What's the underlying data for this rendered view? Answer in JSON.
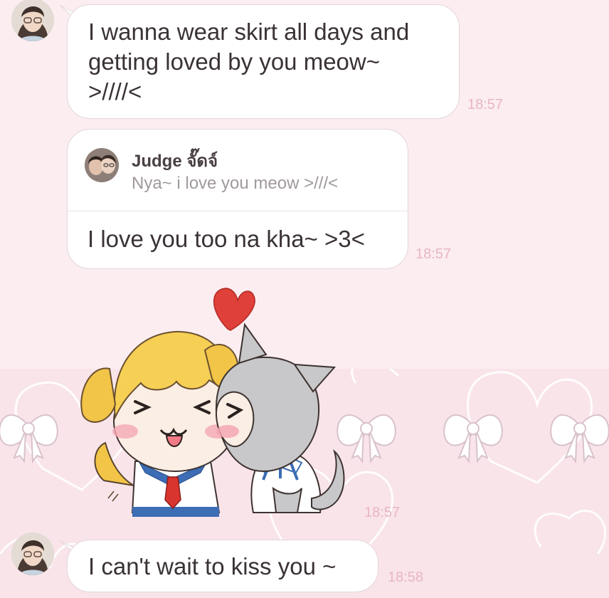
{
  "messages": [
    {
      "text_lines": [
        "I wanna wear skirt all days and",
        "getting loved by you meow~",
        ">////<"
      ],
      "time": "18:57"
    },
    {
      "reply_name": "Judge จั๊ดจ์",
      "reply_quote": "Nya~ i love you meow >///<",
      "text": "I love you too na kha~ >3<",
      "time": "18:57"
    },
    {
      "sticker": "dog-cat-kiss-sticker",
      "time": "18:57"
    },
    {
      "text": "I can't wait to kiss you ~",
      "time": "18:58"
    }
  ],
  "colors": {
    "background_top": "#fbedf0",
    "background_bottom": "#f9e4ea",
    "bubble": "#ffffff",
    "timestamp": "#e8b6c3",
    "text": "#3a3235"
  }
}
